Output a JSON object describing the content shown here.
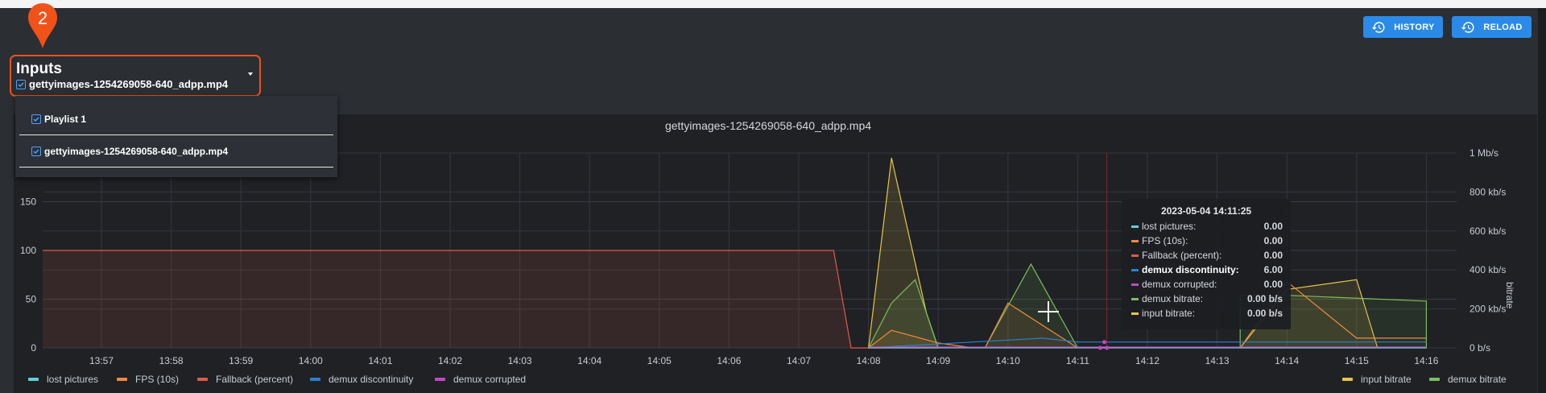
{
  "toolbar": {
    "history_label": "HISTORY",
    "reload_label": "RELOAD",
    "accent": "#2b8ae8"
  },
  "marker": {
    "number": "2",
    "color": "#f0521a"
  },
  "inputs": {
    "title": "Inputs",
    "selected": "gettyimages-1254269058-640_adpp.mp4",
    "dropdown": [
      {
        "label": "Playlist 1",
        "checked": true
      },
      {
        "label": "gettyimages-1254269058-640_adpp.mp4",
        "checked": true
      }
    ]
  },
  "chart_data": {
    "type": "line",
    "title": "gettyimages-1254269058-640_adpp.mp4",
    "x": [
      "13:57",
      "13:58",
      "13:59",
      "14:00",
      "14:01",
      "14:02",
      "14:03",
      "14:04",
      "14:05",
      "14:06",
      "14:07",
      "14:08",
      "14:09",
      "14:10",
      "14:11",
      "14:12",
      "14:13",
      "14:14",
      "14:15",
      "14:16"
    ],
    "y_left_ticks": [
      "0",
      "50",
      "100",
      "150"
    ],
    "y_left_range": [
      0,
      200
    ],
    "y_right_ticks": [
      "0 b/s",
      "200 kb/s",
      "400 kb/s",
      "600 kb/s",
      "800 kb/s",
      "1 Mb/s"
    ],
    "y_right_range": [
      0,
      1000
    ],
    "y_right_label": "bitrate",
    "series": [
      {
        "name": "lost pictures",
        "color": "#5ed0d8",
        "axis": "left",
        "t": [
          13.95,
          14.16
        ],
        "values": [
          0,
          0
        ]
      },
      {
        "name": "FPS (10s)",
        "color": "#f08a3c",
        "axis": "left",
        "t": [
          14.01,
          14.05,
          14.083,
          14.1,
          14.167,
          14.183,
          14.233,
          14.256,
          14.3,
          14.35,
          14.383,
          14.433,
          14.467,
          14.5,
          14.533,
          14.567,
          14.6,
          14.633,
          14.667,
          14.7,
          14.733,
          14.8,
          14.867,
          14.9,
          14.933,
          14.967,
          15.0,
          15.033,
          15.067,
          15.1,
          15.133,
          15.167,
          15.2,
          15.233,
          15.25,
          15.267
        ],
        "values": [
          0,
          0,
          0,
          0,
          0,
          0,
          0,
          0,
          0,
          0,
          0,
          0,
          0,
          0,
          0,
          0,
          0,
          0,
          0,
          0,
          0,
          0,
          0,
          0,
          0,
          0,
          0,
          0,
          0,
          0,
          0,
          0,
          0,
          0,
          0,
          0
        ]
      },
      {
        "name": "Fallback (percent)",
        "color": "#e05a4a",
        "axis": "left",
        "t": [
          13.95,
          14.0,
          14.5,
          14.083,
          14.1,
          14.133,
          14.167
        ],
        "values": [
          100,
          100,
          100,
          100,
          0,
          0,
          0
        ]
      },
      {
        "name": "demux discontinuity",
        "color": "#2c7fd0",
        "axis": "left",
        "t": [
          14.133,
          14.15,
          14.183,
          14.2,
          14.233,
          14.25,
          14.267
        ],
        "values": [
          0,
          5,
          6,
          6,
          6,
          6,
          6
        ]
      },
      {
        "name": "demux corrupted",
        "color": "#c347c6",
        "axis": "left",
        "t": [
          14.133,
          14.267
        ],
        "values": [
          0,
          0
        ]
      },
      {
        "name": "demux bitrate",
        "color": "#7bbf5a",
        "axis": "right",
        "t": [
          14.133,
          14.15,
          14.183,
          14.2,
          14.233,
          14.25,
          14.267
        ],
        "values": [
          0,
          200,
          360,
          200,
          430,
          150,
          0
        ]
      },
      {
        "name": "input bitrate",
        "color": "#e8c547",
        "axis": "right",
        "t": [
          14.133,
          14.15,
          14.183,
          14.2,
          14.233,
          14.25,
          14.267
        ],
        "values": [
          0,
          975,
          300,
          0,
          0,
          0,
          0
        ]
      }
    ],
    "legend_left": [
      "lost pictures",
      "FPS (10s)",
      "Fallback (percent)",
      "demux discontinuity",
      "demux corrupted"
    ],
    "legend_right": [
      "input bitrate",
      "demux bitrate"
    ],
    "grid": true
  },
  "tooltip": {
    "title": "2023-05-04 14:11:25",
    "rows": [
      {
        "label": "lost pictures:",
        "value": "0.00",
        "color": "#5ed0d8"
      },
      {
        "label": "FPS (10s):",
        "value": "0.00",
        "color": "#f08a3c"
      },
      {
        "label": "Fallback (percent):",
        "value": "0.00",
        "color": "#e05a4a"
      },
      {
        "label": "demux discontinuity:",
        "value": "6.00",
        "color": "#2c7fd0",
        "bold": true
      },
      {
        "label": "demux corrupted:",
        "value": "0.00",
        "color": "#c347c6"
      },
      {
        "label": "demux bitrate:",
        "value": "0.00 b/s",
        "color": "#7bbf5a"
      },
      {
        "label": "input bitrate:",
        "value": "0.00 b/s",
        "color": "#e8c547"
      }
    ]
  },
  "legend": {
    "items_left": [
      {
        "label": "lost pictures",
        "color": "#5ed0d8"
      },
      {
        "label": "FPS (10s)",
        "color": "#f08a3c"
      },
      {
        "label": "Fallback (percent)",
        "color": "#e05a4a"
      },
      {
        "label": "demux discontinuity",
        "color": "#2c7fd0"
      },
      {
        "label": "demux corrupted",
        "color": "#c347c6"
      }
    ],
    "items_right": [
      {
        "label": "input bitrate",
        "color": "#e8c547"
      },
      {
        "label": "demux bitrate",
        "color": "#7bbf5a"
      }
    ]
  }
}
